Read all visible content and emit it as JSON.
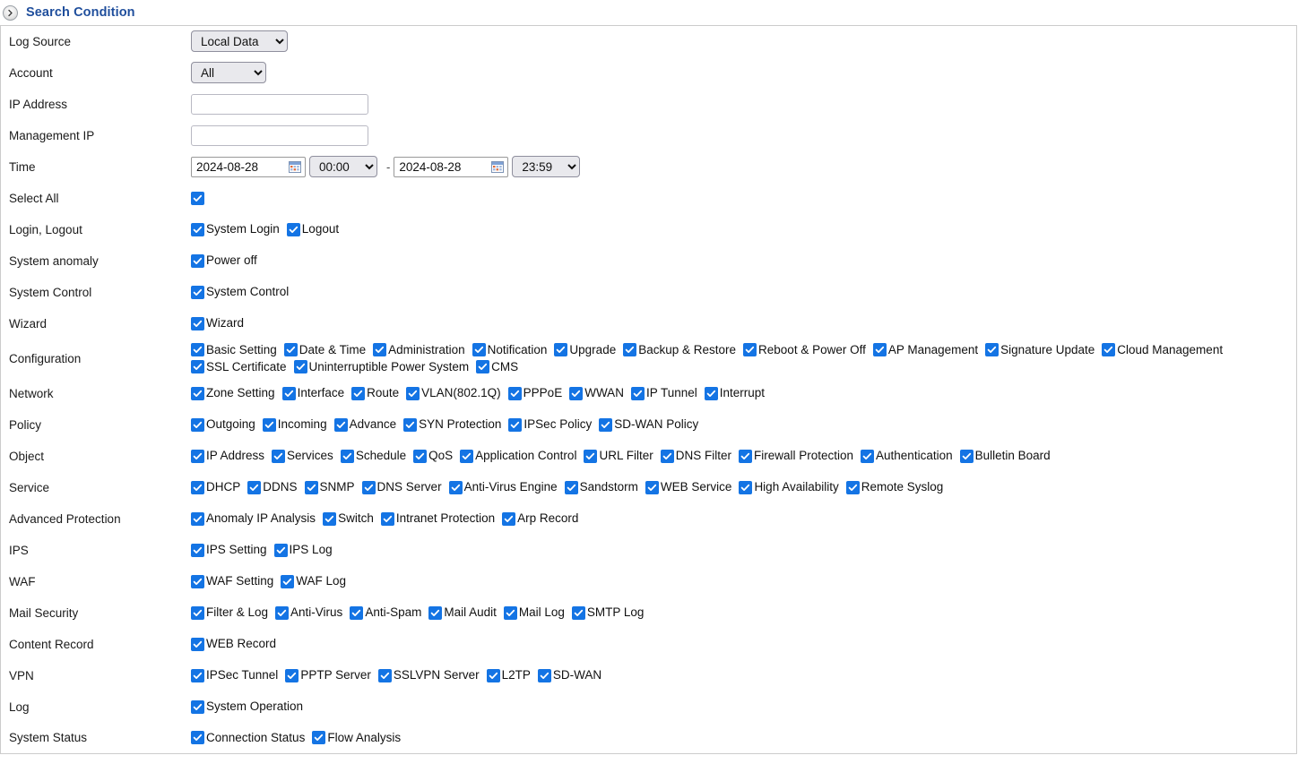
{
  "header": {
    "title": "Search Condition",
    "toggle_icon": "chevron-right-circle-icon"
  },
  "form": {
    "log_source": {
      "label": "Log Source",
      "value": "Local Data",
      "options": [
        "Local Data"
      ]
    },
    "account": {
      "label": "Account",
      "value": "All",
      "options": [
        "All"
      ]
    },
    "ip_address": {
      "label": "IP Address",
      "value": "",
      "placeholder": ""
    },
    "management_ip": {
      "label": "Management IP",
      "value": "",
      "placeholder": ""
    },
    "time": {
      "label": "Time",
      "start_date": "2024-08-28",
      "start_time": "00:00",
      "separator": "-",
      "end_date": "2024-08-28",
      "end_time": "23:59",
      "calendar_icon": "calendar-icon",
      "start_time_options": [
        "00:00"
      ],
      "end_time_options": [
        "23:59"
      ]
    }
  },
  "select_all": {
    "label": "Select All",
    "checked": true
  },
  "categories": [
    {
      "label": "Login, Logout",
      "items": [
        {
          "label": "System Login",
          "checked": true
        },
        {
          "label": "Logout",
          "checked": true
        }
      ]
    },
    {
      "label": "System anomaly",
      "items": [
        {
          "label": "Power off",
          "checked": true
        }
      ]
    },
    {
      "label": "System Control",
      "items": [
        {
          "label": "System Control",
          "checked": true
        }
      ]
    },
    {
      "label": "Wizard",
      "items": [
        {
          "label": "Wizard",
          "checked": true
        }
      ]
    },
    {
      "label": "Configuration",
      "items": [
        {
          "label": "Basic Setting",
          "checked": true
        },
        {
          "label": "Date & Time",
          "checked": true
        },
        {
          "label": "Administration",
          "checked": true
        },
        {
          "label": "Notification",
          "checked": true
        },
        {
          "label": "Upgrade",
          "checked": true
        },
        {
          "label": "Backup & Restore",
          "checked": true
        },
        {
          "label": "Reboot & Power Off",
          "checked": true
        },
        {
          "label": "AP Management",
          "checked": true
        },
        {
          "label": "Signature Update",
          "checked": true
        },
        {
          "label": "Cloud Management",
          "checked": true
        },
        {
          "label": "SSL Certificate",
          "checked": true
        },
        {
          "label": "Uninterruptible Power System",
          "checked": true
        },
        {
          "label": "CMS",
          "checked": true
        }
      ]
    },
    {
      "label": "Network",
      "items": [
        {
          "label": "Zone Setting",
          "checked": true
        },
        {
          "label": "Interface",
          "checked": true
        },
        {
          "label": "Route",
          "checked": true
        },
        {
          "label": "VLAN(802.1Q)",
          "checked": true
        },
        {
          "label": "PPPoE",
          "checked": true
        },
        {
          "label": "WWAN",
          "checked": true
        },
        {
          "label": "IP Tunnel",
          "checked": true
        },
        {
          "label": "Interrupt",
          "checked": true
        }
      ]
    },
    {
      "label": "Policy",
      "items": [
        {
          "label": "Outgoing",
          "checked": true
        },
        {
          "label": "Incoming",
          "checked": true
        },
        {
          "label": "Advance",
          "checked": true
        },
        {
          "label": "SYN Protection",
          "checked": true
        },
        {
          "label": "IPSec Policy",
          "checked": true
        },
        {
          "label": "SD-WAN Policy",
          "checked": true
        }
      ]
    },
    {
      "label": "Object",
      "items": [
        {
          "label": "IP Address",
          "checked": true
        },
        {
          "label": "Services",
          "checked": true
        },
        {
          "label": "Schedule",
          "checked": true
        },
        {
          "label": "QoS",
          "checked": true
        },
        {
          "label": "Application Control",
          "checked": true
        },
        {
          "label": "URL Filter",
          "checked": true
        },
        {
          "label": "DNS Filter",
          "checked": true
        },
        {
          "label": "Firewall Protection",
          "checked": true
        },
        {
          "label": "Authentication",
          "checked": true
        },
        {
          "label": "Bulletin Board",
          "checked": true
        }
      ]
    },
    {
      "label": "Service",
      "items": [
        {
          "label": "DHCP",
          "checked": true
        },
        {
          "label": "DDNS",
          "checked": true
        },
        {
          "label": "SNMP",
          "checked": true
        },
        {
          "label": "DNS Server",
          "checked": true
        },
        {
          "label": "Anti-Virus Engine",
          "checked": true
        },
        {
          "label": "Sandstorm",
          "checked": true
        },
        {
          "label": "WEB Service",
          "checked": true
        },
        {
          "label": "High Availability",
          "checked": true
        },
        {
          "label": "Remote Syslog",
          "checked": true
        }
      ]
    },
    {
      "label": "Advanced Protection",
      "items": [
        {
          "label": "Anomaly IP Analysis",
          "checked": true
        },
        {
          "label": "Switch",
          "checked": true
        },
        {
          "label": "Intranet Protection",
          "checked": true
        },
        {
          "label": "Arp Record",
          "checked": true
        }
      ]
    },
    {
      "label": "IPS",
      "items": [
        {
          "label": "IPS Setting",
          "checked": true
        },
        {
          "label": "IPS Log",
          "checked": true
        }
      ]
    },
    {
      "label": "WAF",
      "items": [
        {
          "label": "WAF Setting",
          "checked": true
        },
        {
          "label": "WAF Log",
          "checked": true
        }
      ]
    },
    {
      "label": "Mail Security",
      "items": [
        {
          "label": "Filter & Log",
          "checked": true
        },
        {
          "label": "Anti-Virus",
          "checked": true
        },
        {
          "label": "Anti-Spam",
          "checked": true
        },
        {
          "label": "Mail Audit",
          "checked": true
        },
        {
          "label": "Mail Log",
          "checked": true
        },
        {
          "label": "SMTP Log",
          "checked": true
        }
      ]
    },
    {
      "label": "Content Record",
      "items": [
        {
          "label": "WEB Record",
          "checked": true
        }
      ]
    },
    {
      "label": "VPN",
      "items": [
        {
          "label": "IPSec Tunnel",
          "checked": true
        },
        {
          "label": "PPTP Server",
          "checked": true
        },
        {
          "label": "SSLVPN Server",
          "checked": true
        },
        {
          "label": "L2TP",
          "checked": true
        },
        {
          "label": "SD-WAN",
          "checked": true
        }
      ]
    },
    {
      "label": "Log",
      "items": [
        {
          "label": "System Operation",
          "checked": true
        }
      ]
    },
    {
      "label": "System Status",
      "items": [
        {
          "label": "Connection Status",
          "checked": true
        },
        {
          "label": "Flow Analysis",
          "checked": true
        }
      ]
    }
  ],
  "colors": {
    "title": "#1f4e9c",
    "checkbox": "#1474e4",
    "border": "#cccccc",
    "control_bg": "#e9e9ed"
  }
}
